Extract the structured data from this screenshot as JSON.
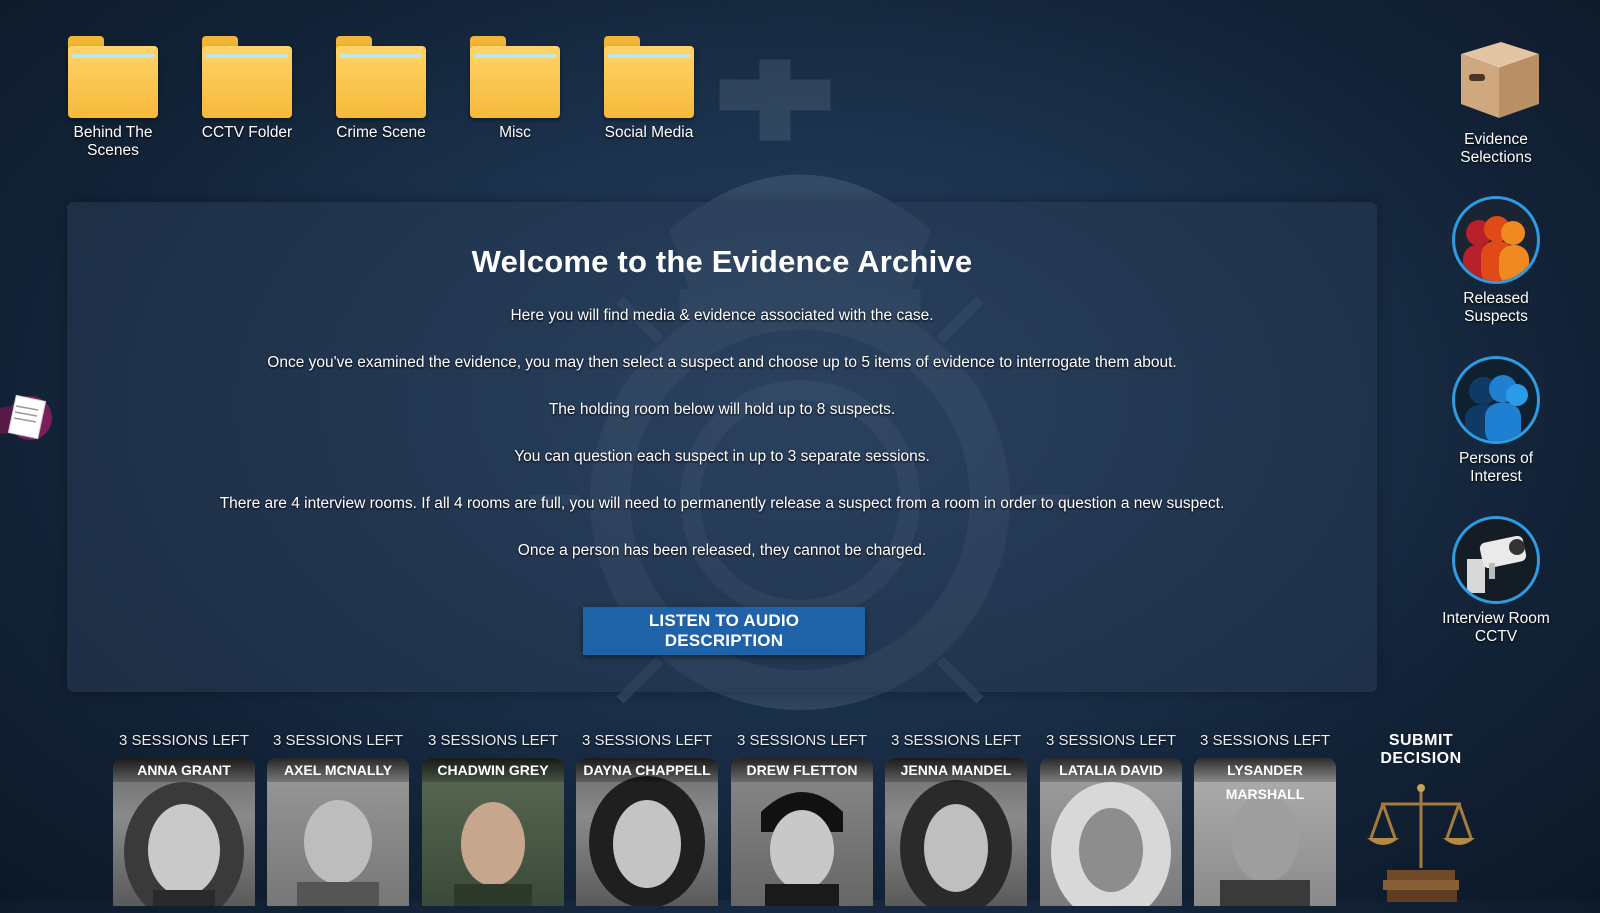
{
  "folders": [
    {
      "label": "Behind The Scenes",
      "icon": "folder-icon"
    },
    {
      "label": "CCTV Folder",
      "icon": "folder-icon"
    },
    {
      "label": "Crime Scene",
      "icon": "folder-icon"
    },
    {
      "label": "Misc",
      "icon": "folder-icon"
    },
    {
      "label": "Social Media",
      "icon": "folder-icon"
    }
  ],
  "right_panel": {
    "evidence": {
      "label": "Evidence Selections",
      "icon": "evidence-box-icon"
    },
    "released": {
      "label": "Released Suspects",
      "icon": "released-suspects-icon"
    },
    "persons": {
      "label": "Persons of Interest",
      "icon": "persons-of-interest-icon"
    },
    "cctv": {
      "label": "Interview Room CCTV",
      "icon": "cctv-camera-icon"
    }
  },
  "welcome": {
    "title": "Welcome to the Evidence Archive",
    "paragraphs": [
      "Here you will find media & evidence associated with the case.",
      "Once you've examined the evidence, you may then select a suspect and choose up to 5 items of evidence to interrogate them about.",
      "The holding room below will hold up to 8 suspects.",
      "You can question each suspect in up to 3 separate sessions.",
      "There are 4 interview rooms. If all 4 rooms are full, you will need to permanently release a suspect from a room in order to question a new suspect.",
      "Once a person has been released, they cannot be charged."
    ],
    "audio_button": "LISTEN TO AUDIO DESCRIPTION"
  },
  "suspects": [
    {
      "sessions": "3 SESSIONS LEFT",
      "name": "ANNA GRANT"
    },
    {
      "sessions": "3 SESSIONS LEFT",
      "name": "AXEL MCNALLY"
    },
    {
      "sessions": "3 SESSIONS LEFT",
      "name": "CHADWIN GREY"
    },
    {
      "sessions": "3 SESSIONS LEFT",
      "name": "DAYNA CHAPPELL"
    },
    {
      "sessions": "3 SESSIONS LEFT",
      "name": "DREW FLETTON"
    },
    {
      "sessions": "3 SESSIONS LEFT",
      "name": "JENNA MANDEL"
    },
    {
      "sessions": "3 SESSIONS LEFT",
      "name": "LATALIA DAVID"
    },
    {
      "sessions": "3 SESSIONS LEFT",
      "name": "LYSANDER MARSHALL"
    }
  ],
  "submit": {
    "label": "SUBMIT DECISION",
    "icon": "scales-of-justice-icon"
  },
  "notebook": {
    "icon": "notebook-icon"
  },
  "colors": {
    "accent": "#1f62a8",
    "folder": "#f6b93a",
    "circle_border": "#2f9be0"
  }
}
